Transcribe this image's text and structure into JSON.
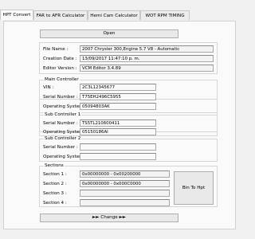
{
  "tabs": [
    {
      "label": "HPT Convert"
    },
    {
      "label": "FAR to AFR Calculator"
    },
    {
      "label": "Hemi Cam Calculator"
    },
    {
      "label": "WOT RPM TIMING"
    }
  ],
  "open_button": "Open",
  "file_info": {
    "file_name_label": "File Name :",
    "file_name_value": "2007 Chrysler 300,Engine 5.7 V8 - Automatic",
    "creation_date_label": "Creation Date :",
    "creation_date_value": "13/09/2017 11:47:10 p. m.",
    "editor_version_label": "Editor Version :",
    "editor_version_value": "VCM Editor 3.4.89"
  },
  "main_controller": {
    "title": "Main Controller",
    "vin_label": "VIN :",
    "vin_value": "2C3L12345677",
    "serial_label": "Serial Number :",
    "serial_value": "T75EH2496C5955",
    "os_label": "Operating System :",
    "os_value": "05094803AK"
  },
  "sub_controller_1": {
    "title": "Sub Controller 1",
    "serial_label": "Serial Number :",
    "serial_value": "TS5TL210600411",
    "os_label": "Operating System :",
    "os_value": "05150186AI"
  },
  "sub_controller_2": {
    "title": "Sub Controller 2",
    "serial_label": "Serial Number :",
    "serial_value": "",
    "os_label": "Operating System :",
    "os_value": ""
  },
  "sections": {
    "title": "Sections",
    "s1_label": "Section 1 :",
    "s1_value": "0x00000000 - 0x00200000",
    "s2_label": "Section 2 :",
    "s2_value": "0x00000000 - 0x000C0000",
    "s3_label": "Section 3 :",
    "s3_value": "",
    "s4_label": "Section 4 :",
    "s4_value": "",
    "bin_button": "Bin To Hpt"
  },
  "change_button": "►► Change ►►"
}
